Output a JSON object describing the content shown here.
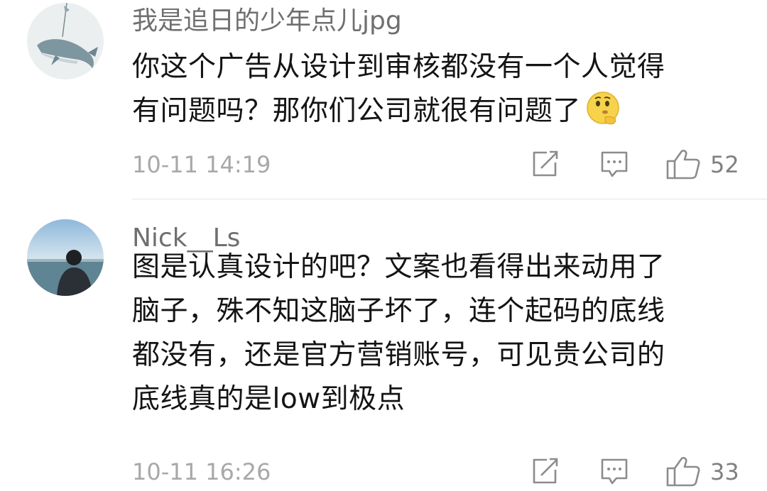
{
  "comments": [
    {
      "username": "我是追日的少年点儿jpg",
      "text_lines": [
        "你这个广告从设计到审核都没有一个人觉得",
        "有问题吗？那你们公司就很有问题了"
      ],
      "emoji": "thinking-face-emoji",
      "timestamp": "10-11 14:19",
      "likes": "52",
      "avatar": "whale-illustration"
    },
    {
      "username": "Nick__Ls",
      "text_lines": [
        "图是认真设计的吧？文案也看得出来动用了",
        "脑子，殊不知这脑子坏了，连个起码的底线",
        "都没有，还是官方营销账号，可见贵公司的",
        "底线真的是low到极点"
      ],
      "timestamp": "10-11 16:26",
      "likes": "33",
      "avatar": "person-by-sea-photo"
    }
  ],
  "icons": {
    "share": "share-icon",
    "comment": "comment-icon",
    "like": "thumbs-up-icon"
  },
  "colors": {
    "username": "#6f6f6f",
    "text": "#141414",
    "meta": "#a8a8a8",
    "divider": "#e6e6e6"
  }
}
